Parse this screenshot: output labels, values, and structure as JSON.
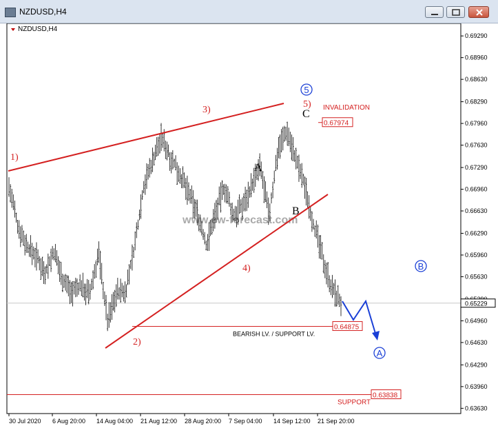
{
  "window": {
    "title": "NZDUSD,H4"
  },
  "chart_data": {
    "type": "candlestick",
    "symbol_label": "NZDUSD,H4",
    "y_ticks": [
      "0.69290",
      "0.68960",
      "0.68630",
      "0.68290",
      "0.67960",
      "0.67630",
      "0.67290",
      "0.66960",
      "0.66630",
      "0.66290",
      "0.65960",
      "0.65630",
      "0.65290",
      "0.64960",
      "0.64630",
      "0.64290",
      "0.63960",
      "0.63630"
    ],
    "x_ticks": [
      "30 Jul 2020",
      "6 Aug 20:00",
      "14 Aug 04:00",
      "21 Aug 12:00",
      "28 Aug 20:00",
      "7 Sep 04:00",
      "14 Sep 12:00",
      "21 Sep 20:00"
    ],
    "ylim": [
      0.6355,
      0.6948
    ],
    "current_price": "0.65229",
    "price_path": [
      {
        "x": "30 Jul 2020",
        "y": 0.67
      },
      {
        "x": "31 Jul",
        "y": 0.664
      },
      {
        "x": "2 Aug",
        "y": 0.661
      },
      {
        "x": "4 Aug",
        "y": 0.6595
      },
      {
        "x": "6 Aug",
        "y": 0.657
      },
      {
        "x": "9 Aug",
        "y": 0.66
      },
      {
        "x": "11 Aug",
        "y": 0.656
      },
      {
        "x": "13 Aug",
        "y": 0.654
      },
      {
        "x": "14 Aug",
        "y": 0.655
      },
      {
        "x": "16 Aug",
        "y": 0.6535
      },
      {
        "x": "17 Aug",
        "y": 0.66
      },
      {
        "x": "18 Aug",
        "y": 0.6495
      },
      {
        "x": "19 Aug",
        "y": 0.654
      },
      {
        "x": "21 Aug",
        "y": 0.654
      },
      {
        "x": "23 Aug",
        "y": 0.661
      },
      {
        "x": "25 Aug",
        "y": 0.67
      },
      {
        "x": "27 Aug",
        "y": 0.674
      },
      {
        "x": "28 Aug",
        "y": 0.6775
      },
      {
        "x": "30 Aug",
        "y": 0.6745
      },
      {
        "x": "1 Sep",
        "y": 0.672
      },
      {
        "x": "3 Sep",
        "y": 0.669
      },
      {
        "x": "5 Sep",
        "y": 0.666
      },
      {
        "x": "7 Sep",
        "y": 0.661
      },
      {
        "x": "9 Sep",
        "y": 0.666
      },
      {
        "x": "10 Sep",
        "y": 0.67
      },
      {
        "x": "11 Sep",
        "y": 0.6655
      },
      {
        "x": "12 Sep",
        "y": 0.667
      },
      {
        "x": "14 Sep",
        "y": 0.67
      },
      {
        "x": "16 Sep",
        "y": 0.673
      },
      {
        "x": "17 Sep",
        "y": 0.6655
      },
      {
        "x": "18 Sep",
        "y": 0.676
      },
      {
        "x": "19 Sep",
        "y": 0.6785
      },
      {
        "x": "20 Sep",
        "y": 0.674
      },
      {
        "x": "21 Sep",
        "y": 0.67
      },
      {
        "x": "21 Sep 20:00",
        "y": 0.664
      },
      {
        "x": "23 Sep",
        "y": 0.659
      },
      {
        "x": "24 Sep",
        "y": 0.6545
      },
      {
        "x": "25 Sep",
        "y": 0.6523
      }
    ],
    "levels": [
      {
        "label": "INVALIDATION",
        "value": "0.67974",
        "color": "#d42020"
      },
      {
        "label": "BEARISH LV. / SUPPORT LV.",
        "value": "0.64875",
        "color": "#d42020"
      },
      {
        "label": "SUPPORT",
        "value": "0.63838",
        "color": "#d42020"
      }
    ],
    "wave_labels": {
      "w1": "1)",
      "w2": "2)",
      "w3": "3)",
      "w4": "4)",
      "w5": "5)",
      "A": "A",
      "B": "B",
      "C": "C",
      "circle5": "5",
      "circleA": "A",
      "circleB": "B"
    },
    "watermark": "www.ew-forecast.com",
    "colors": {
      "trendline": "#d42020",
      "projection": "#1a3fd6",
      "candles": "#000000",
      "grid": "#c8c8c8"
    }
  }
}
